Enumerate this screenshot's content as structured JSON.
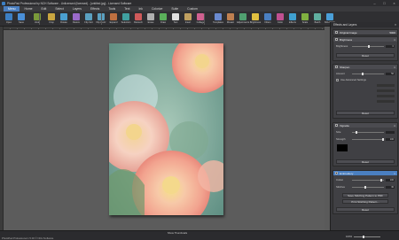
{
  "titlebar": {
    "title": "PhotoPad Professional by NCH Software - Unlicensed (licensed) - [untitled.jpg] - Licensed Software"
  },
  "menubar": {
    "items": [
      "Menu",
      "Home",
      "Edit",
      "Select",
      "Layers",
      "Effects",
      "Tools",
      "Text",
      "Ink",
      "Colorize",
      "Suite",
      "Custom"
    ],
    "selected": 0
  },
  "toolbar": {
    "buttons": [
      "Open",
      "Save",
      "Undo",
      "Crop",
      "Rotate",
      "Resize",
      "Flip Vert",
      "Flip Horiz",
      "Expand",
      "Selection",
      "Retouch",
      "Erase",
      "Draw",
      "Text",
      "Insert",
      "Collage",
      "Templates",
      "Mosaic",
      "Adjustments",
      "Brightness",
      "Filters",
      "Color",
      "Effects",
      "Scale",
      "Batch",
      "NCH Suite"
    ]
  },
  "panel": {
    "title": "Effects and Layers",
    "original_section": {
      "label": "Original Image",
      "value": "5000"
    },
    "brightness": {
      "label": "Brightness",
      "row_label": "Brightness",
      "value": "0",
      "reset": "Reset"
    },
    "sharpen": {
      "label": "Sharpen",
      "amount_label": "Amount",
      "amount_value": "50",
      "advanced_label": "Use Advanced Settings",
      "reset": "Reset"
    },
    "vignette": {
      "label": "Vignette",
      "size_label": "Size",
      "strength_label": "Strength",
      "strength_value": "100",
      "color_label": "",
      "reset": "Reset"
    },
    "embroidery": {
      "label": "Embroidery",
      "cotton_label": "Cotton",
      "cotton_value": "100",
      "stitches_label": "Stitches",
      "stitches_value": "30",
      "btn_save": "Save Stitching Pattern to PDF",
      "btn_print": "Print Stitching Pattern...",
      "reset": "Reset"
    }
  },
  "statusbar": {
    "left": "PhotoPad Professional v 5.00 © NCH Software",
    "thumbs": "Show Thumbnails",
    "zoom": "100%"
  },
  "colors": {
    "accent": "#4a7fc1",
    "titlebar": "#2d2d30",
    "panel": "#38383b",
    "canvas": "#5c5c5c"
  }
}
